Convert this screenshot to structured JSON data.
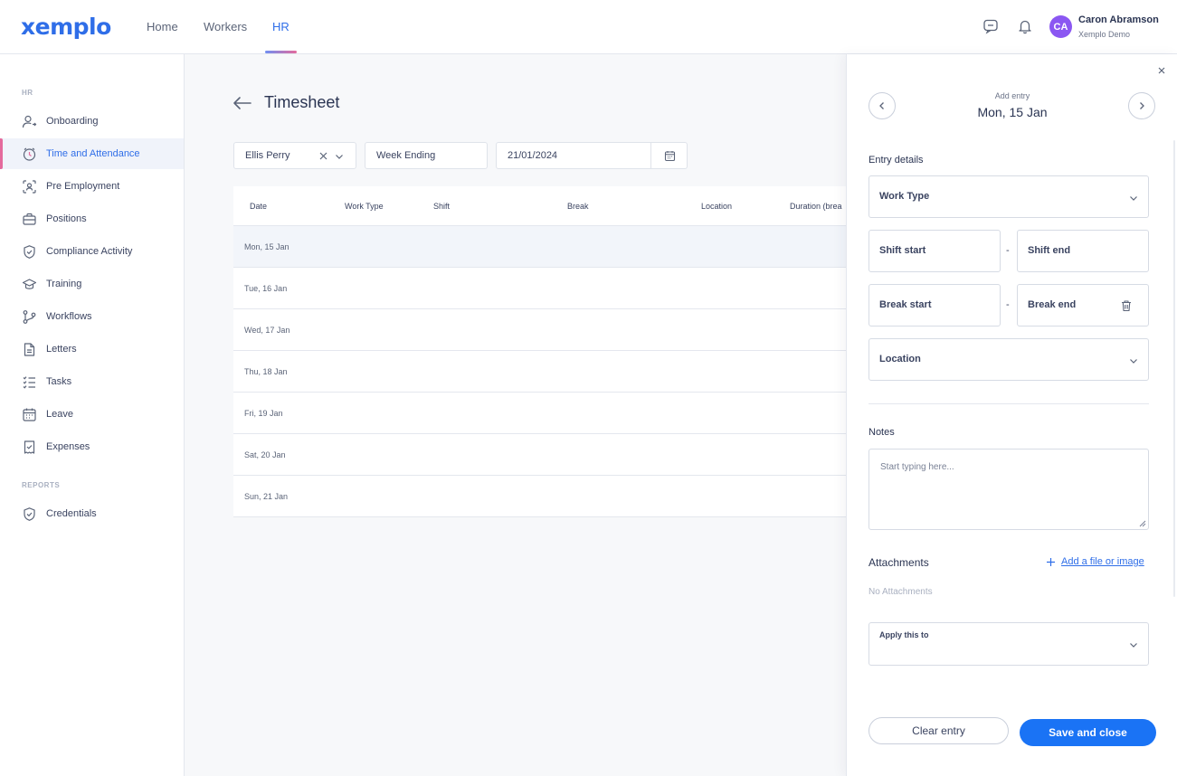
{
  "brand": {
    "logo": "xemplo"
  },
  "nav": {
    "home": "Home",
    "workers": "Workers",
    "hr": "HR"
  },
  "user": {
    "initials": "CA",
    "name": "Caron Abramson",
    "org": "Xemplo Demo"
  },
  "sidebar": {
    "section_hr": "HR",
    "items": [
      {
        "label": "Onboarding",
        "icon": "user-add-icon"
      },
      {
        "label": "Time and Attendance",
        "icon": "clock-icon"
      },
      {
        "label": "Pre Employment",
        "icon": "user-scan-icon"
      },
      {
        "label": "Positions",
        "icon": "briefcase-icon"
      },
      {
        "label": "Compliance Activity",
        "icon": "shield-check-icon"
      },
      {
        "label": "Training",
        "icon": "graduation-cap-icon"
      },
      {
        "label": "Workflows",
        "icon": "workflow-icon"
      },
      {
        "label": "Letters",
        "icon": "document-icon"
      },
      {
        "label": "Tasks",
        "icon": "checklist-icon"
      },
      {
        "label": "Leave",
        "icon": "calendar-icon"
      },
      {
        "label": "Expenses",
        "icon": "receipt-icon"
      }
    ],
    "section_reports": "REPORTS",
    "reports_items": [
      {
        "label": "Credentials",
        "icon": "shield-check-icon"
      }
    ]
  },
  "page": {
    "title": "Timesheet",
    "filters": {
      "worker": "Ellis Perry",
      "period": "Week Ending",
      "date": "21/01/2024"
    }
  },
  "table": {
    "headers": [
      "Date",
      "Work Type",
      "Shift",
      "Break",
      "Location",
      "Duration (brea"
    ],
    "rows": [
      "Mon, 15 Jan",
      "Tue, 16 Jan",
      "Wed, 17 Jan",
      "Thu, 18 Jan",
      "Fri, 19 Jan",
      "Sat, 20 Jan",
      "Sun, 21 Jan"
    ]
  },
  "drawer": {
    "subtitle": "Add entry",
    "date": "Mon, 15 Jan",
    "entry_details": "Entry details",
    "work_type": "Work Type",
    "shift_start": "Shift start",
    "shift_end": "Shift end",
    "break_start": "Break start",
    "break_end": "Break end",
    "location": "Location",
    "separator": "-",
    "notes_label": "Notes",
    "notes_placeholder": "Start typing here...",
    "attachments_label": "Attachments",
    "add_file": "Add a file or image",
    "no_attachments": "No Attachments",
    "apply_label": "Apply this to",
    "clear_button": "Clear entry",
    "save_button": "Save and close"
  },
  "colors": {
    "accent": "#2f6ee8",
    "primary_button": "#1a73f5",
    "avatar": "#8b57f2",
    "active_marker": "#e46a9c"
  }
}
